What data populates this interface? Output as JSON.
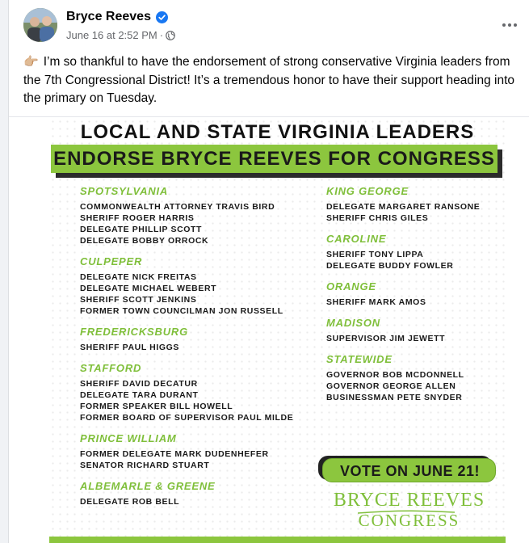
{
  "post": {
    "author": "Bryce Reeves",
    "timestamp": "June 16 at 2:52 PM",
    "separator": "·",
    "hand_emoji": "👉🏼",
    "text": "I’m so thankful to have the endorsement of strong conservative Virginia leaders from the 7th Congressional District! It’s a tremendous honor to have their support heading into the primary on Tuesday.",
    "icons": [
      "verified-badge-icon",
      "globe-icon",
      "more-options-icon"
    ]
  },
  "graphic": {
    "title_line1": "LOCAL AND STATE VIRGINIA LEADERS",
    "title_line2": "ENDORSE BRYCE REEVES FOR CONGRESS",
    "left_groups": [
      {
        "name": "SPOTSYLVANIA",
        "members": [
          "COMMONWEALTH ATTORNEY TRAVIS BIRD",
          "SHERIFF ROGER HARRIS",
          "DELEGATE PHILLIP SCOTT",
          "DELEGATE BOBBY ORROCK"
        ]
      },
      {
        "name": "CULPEPER",
        "members": [
          "DELEGATE NICK FREITAS",
          "DELEGATE MICHAEL WEBERT",
          "SHERIFF SCOTT JENKINS",
          "FORMER TOWN COUNCILMAN JON RUSSELL"
        ]
      },
      {
        "name": "FREDERICKSBURG",
        "members": [
          "SHERIFF PAUL HIGGS"
        ]
      },
      {
        "name": "STAFFORD",
        "members": [
          "SHERIFF DAVID DECATUR",
          "DELEGATE TARA DURANT",
          "FORMER SPEAKER BILL HOWELL",
          "FORMER BOARD OF SUPERVISOR PAUL MILDE"
        ]
      },
      {
        "name": "PRINCE WILLIAM",
        "members": [
          "FORMER DELEGATE MARK DUDENHEFER",
          "SENATOR RICHARD STUART"
        ]
      },
      {
        "name": "ALBEMARLE & GREENE",
        "members": [
          "DELEGATE ROB BELL"
        ]
      }
    ],
    "right_groups": [
      {
        "name": "KING GEORGE",
        "members": [
          "DELEGATE MARGARET RANSONE",
          "SHERIFF CHRIS GILES"
        ]
      },
      {
        "name": "CAROLINE",
        "members": [
          "SHERIFF TONY LIPPA",
          "DELEGATE BUDDY FOWLER"
        ]
      },
      {
        "name": "ORANGE",
        "members": [
          "SHERIFF MARK AMOS"
        ]
      },
      {
        "name": "MADISON",
        "members": [
          "SUPERVISOR JIM JEWETT"
        ]
      },
      {
        "name": "STATEWIDE",
        "members": [
          "GOVERNOR BOB MCDONNELL",
          "GOVERNOR GEORGE ALLEN",
          "BUSINESSMAN PETE SNYDER"
        ]
      }
    ],
    "vote_text": "VOTE ON JUNE 21!",
    "logo_name": "BRYCE REEVES",
    "logo_sub": "CONGRESS"
  },
  "colors": {
    "accent_green": "#8cc63e",
    "group_title_green": "#7fbf3a",
    "facebook_blue": "#1877f2",
    "text_dark": "#050505",
    "text_muted": "#65676b"
  }
}
